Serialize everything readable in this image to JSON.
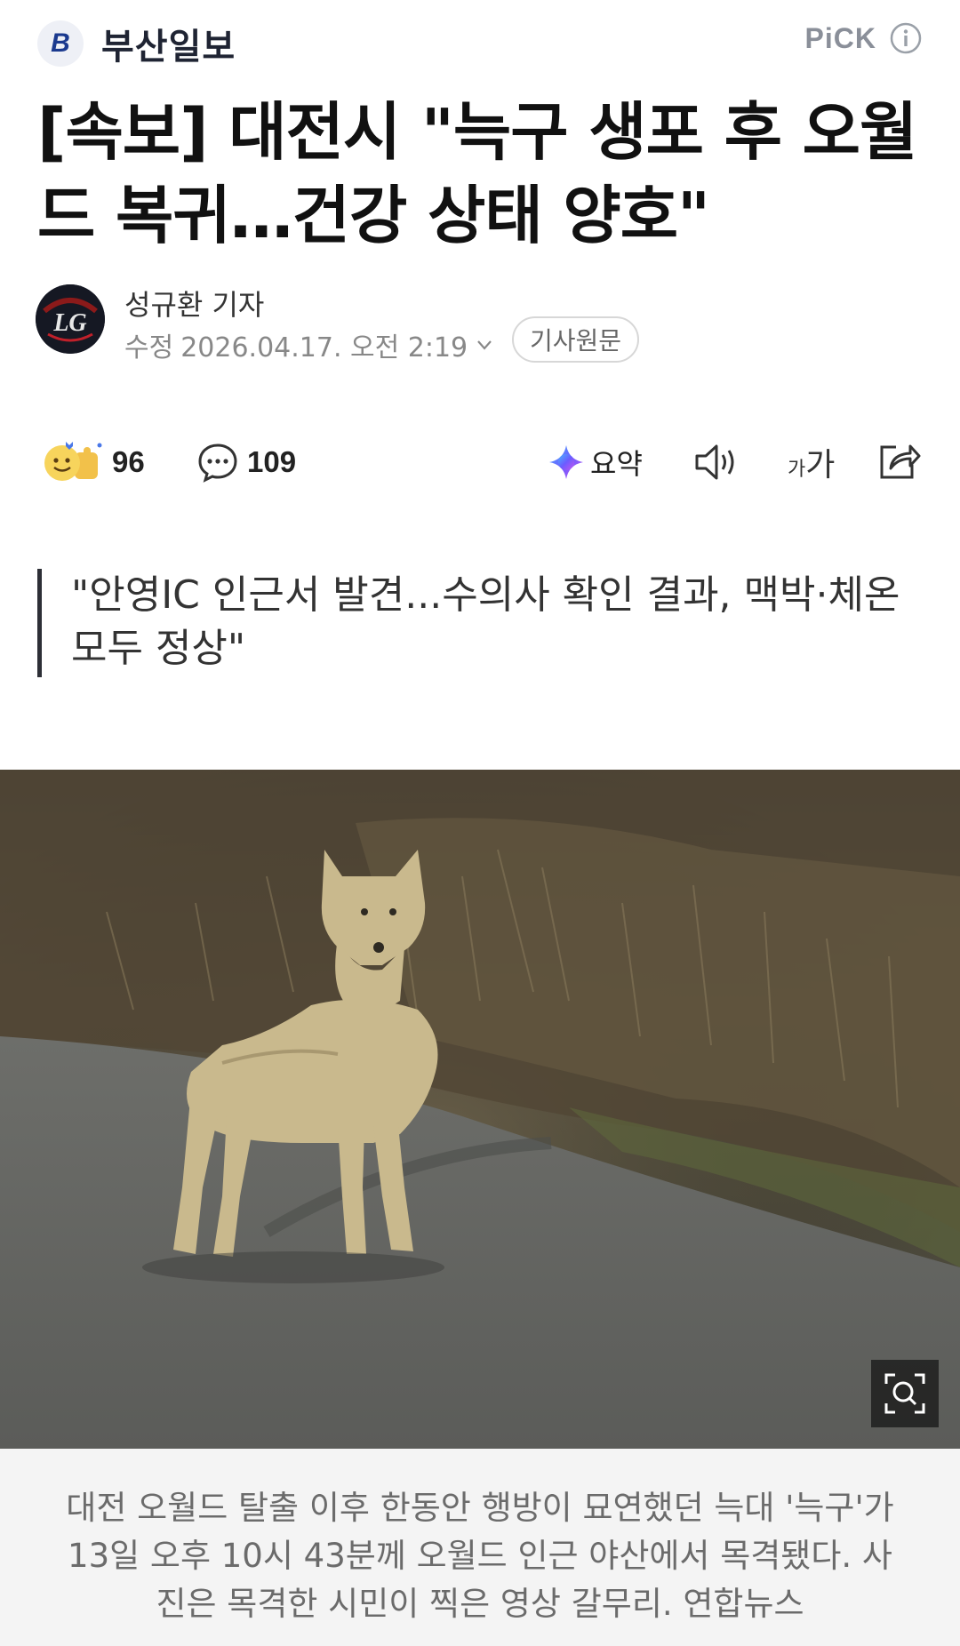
{
  "header": {
    "logo_letter": "B",
    "publisher": "부산일보",
    "pick_label": "PiCK"
  },
  "article": {
    "headline": "[속보] 대전시 \"늑구 생포 후 오월드 복귀…건강 상태 양호\"",
    "reporter": "성규환 기자",
    "modified_label": "수정",
    "modified_datetime": "2026.04.17. 오전 2:19",
    "original_button": "기사원문",
    "subheading": "\"안영IC 인근서 발견...수의사 확인 결과, 맥박·체온 모두 정상\"",
    "caption": "대전 오월드 탈출 이후 한동안 행방이 묘연했던 늑대 '늑구'가 13일 오후 10시 43분께 오월드 인근 야산에서 목격됐다. 사진은 목격한 시민이 찍은 영상 갈무리. 연합뉴스"
  },
  "actions": {
    "reactions_count": "96",
    "comments_count": "109",
    "summary_label": "요약",
    "font_size_label_small": "가",
    "font_size_label_large": "가"
  },
  "colors": {
    "accent_summary": "#6c5cff",
    "headline_text": "#111111",
    "caption_bg": "#f4f4f4"
  },
  "icons": [
    "info-icon",
    "chevron-down-icon",
    "reaction-emoji-icon",
    "comment-icon",
    "ai-summary-icon",
    "speaker-icon",
    "font-size-icon",
    "share-icon",
    "zoom-icon"
  ]
}
